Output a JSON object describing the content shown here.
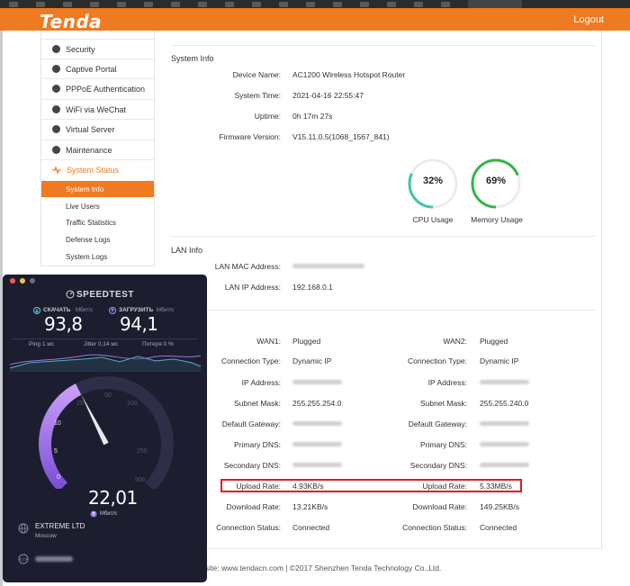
{
  "app": {
    "logo": "Tenda",
    "logout": "Logout"
  },
  "sidebar": {
    "items": [
      {
        "label": "Security"
      },
      {
        "label": "Captive Portal"
      },
      {
        "label": "PPPoE Authentication"
      },
      {
        "label": "WiFi via WeChat"
      },
      {
        "label": "Virtual Server"
      },
      {
        "label": "Maintenance"
      },
      {
        "label": "System Status"
      }
    ],
    "subitems": [
      {
        "label": "System Info"
      },
      {
        "label": "Live Users"
      },
      {
        "label": "Traffic Statistics"
      },
      {
        "label": "Defense Logs"
      },
      {
        "label": "System Logs"
      }
    ]
  },
  "system_info": {
    "title": "System Info",
    "device_name_label": "Device Name:",
    "device_name": "AC1200 Wireless Hotspot Router",
    "system_time_label": "System Time:",
    "system_time": "2021-04-16 22:55:47",
    "uptime_label": "Uptime:",
    "uptime": "0h 17m 27s",
    "firmware_label": "Firmware Version:",
    "firmware": "V15.11.0.5(1068_1567_841)",
    "cpu": {
      "value": "32%",
      "label": "CPU Usage",
      "fraction": 0.32,
      "color": "#3cc6a5"
    },
    "memory": {
      "value": "69%",
      "label": "Memory Usage",
      "fraction": 0.69,
      "color": "#35b44a"
    }
  },
  "lan_info": {
    "title": "LAN Info",
    "mac_label": "LAN MAC Address:",
    "ip_label": "LAN IP Address:",
    "ip": "192.168.0.1"
  },
  "wan": {
    "wan1": {
      "label": "WAN1:",
      "status": "Plugged",
      "conn_type_label": "Connection Type:",
      "conn_type": "Dynamic IP",
      "ip_label": "IP Address:",
      "mask_label": "Subnet Mask:",
      "mask": "255.255.254.0",
      "gateway_label": "Default Gateway:",
      "dns1_label": "Primary DNS:",
      "dns2_label": "Secondary DNS:",
      "upload_label": "Upload Rate:",
      "upload": "4.93KB/s",
      "download_label": "Download Rate:",
      "download": "13.21KB/s",
      "conn_status_label": "Connection Status:",
      "conn_status": "Connected"
    },
    "wan2": {
      "label": "WAN2:",
      "status": "Plugged",
      "conn_type_label": "Connection Type:",
      "conn_type": "Dynamic IP",
      "ip_label": "IP Address:",
      "mask_label": "Subnet Mask:",
      "mask": "255.255.240.0",
      "gateway_label": "Default Gateway:",
      "dns1_label": "Primary DNS:",
      "dns2_label": "Secondary DNS:",
      "upload_label": "Upload Rate:",
      "upload": "5.33MB/s",
      "download_label": "Download Rate:",
      "download": "149.25KB/s",
      "conn_status_label": "Connection Status:",
      "conn_status": "Connected"
    }
  },
  "footer": {
    "text": "site: www.tendacn.com | ©2017 Shenzhen Tenda Technology Co.,Ltd."
  },
  "speedtest": {
    "brand": "SPEEDTEST",
    "download_label": "СКАЧАТЬ",
    "download_unit": "Мбит/с",
    "download_value": "93,8",
    "upload_label": "ЗАГРУЗИТЬ",
    "upload_unit": "Мбит/с",
    "upload_value": "94,1",
    "ping": "Ping 1 мс",
    "jitter": "Jitter 0,14 мс",
    "loss": "Потеря 0 %",
    "gauge_ticks": [
      "0",
      "5",
      "10",
      "25",
      "50",
      "100",
      "250",
      "500"
    ],
    "result": "22,01",
    "result_unit": "Мбит/с",
    "isp": "EXTREME LTD",
    "city": "Moscow",
    "gauge_value": 22.01
  }
}
